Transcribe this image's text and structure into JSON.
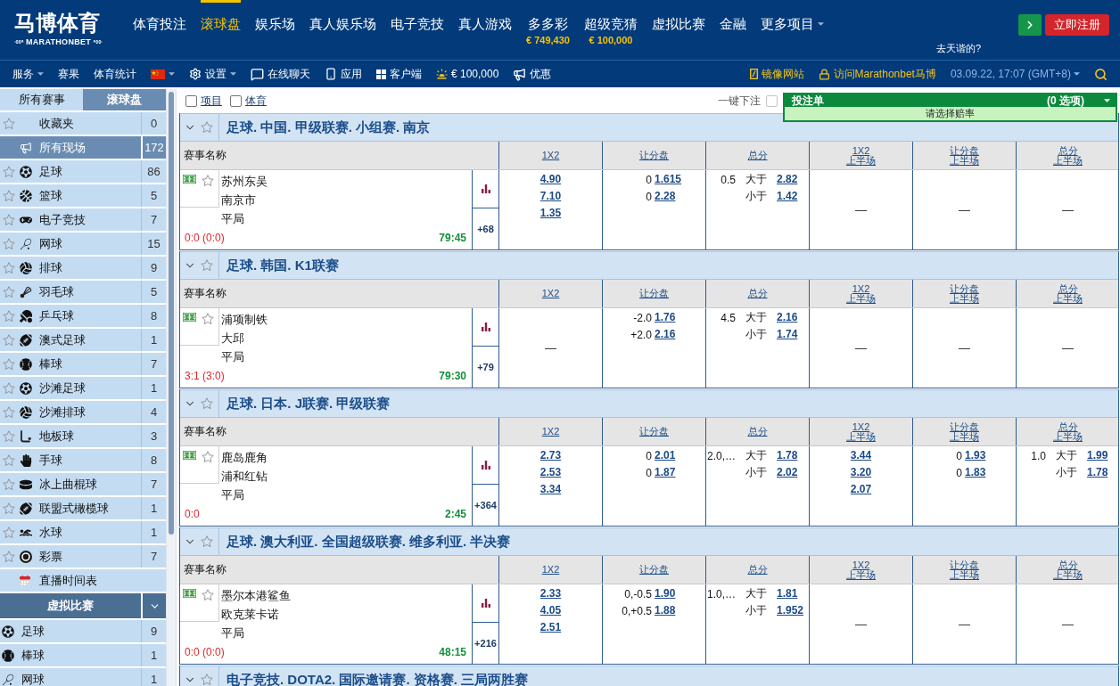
{
  "header": {
    "logo": {
      "title": "马博体育",
      "subtitle": "MARATHONBET"
    },
    "nav": [
      {
        "label": "体育投注",
        "kind": "link",
        "selected": false
      },
      {
        "label": "滚球盘",
        "kind": "link",
        "selected": true
      },
      {
        "label": "娱乐场",
        "kind": "link",
        "selected": false
      },
      {
        "label": "真人娱乐场",
        "kind": "link",
        "selected": false
      },
      {
        "label": "电子竞技",
        "kind": "link",
        "selected": false
      },
      {
        "label": "真人游戏",
        "kind": "link",
        "selected": false
      },
      {
        "label": "多多彩",
        "kind": "link",
        "selected": false,
        "jackpot": "€ 749,430"
      },
      {
        "label": "超级竞猜",
        "kind": "link",
        "selected": false,
        "jackpot": "€ 100,000"
      },
      {
        "label": "虚拟比赛",
        "kind": "link",
        "selected": false
      },
      {
        "label": "金融",
        "kind": "link",
        "selected": false
      },
      {
        "label": "更多项目",
        "kind": "menu",
        "selected": false
      }
    ],
    "register_button": "立即注册",
    "hint": "去天谐的?"
  },
  "toolbar": {
    "items": [
      {
        "kind": "menu",
        "label": "服务"
      },
      {
        "kind": "link",
        "label": "赛果"
      },
      {
        "kind": "link",
        "label": "体育统计"
      },
      {
        "kind": "flag"
      },
      {
        "kind": "menu",
        "label": "设置"
      },
      {
        "kind": "link",
        "label": "在线聊天"
      },
      {
        "kind": "link",
        "label": "应用"
      },
      {
        "kind": "link",
        "label": "客户端"
      },
      {
        "kind": "link",
        "label": "€ 100,000"
      },
      {
        "kind": "link",
        "label": "优惠"
      }
    ],
    "right_links": [
      {
        "label": "镜像网站"
      },
      {
        "label": "访问Marathonbet马博"
      }
    ],
    "datetime": "03.09.22, 17:07 (GMT+8)"
  },
  "sidebar": {
    "tabs": [
      {
        "label": "所有赛事",
        "selected": false
      },
      {
        "label": "滚球盘",
        "selected": true
      }
    ],
    "items": [
      {
        "kind": "favorites",
        "label": "收藏夹",
        "count": "0",
        "selected": false
      },
      {
        "kind": "live",
        "label": "所有现场",
        "count": "172",
        "selected": true
      },
      {
        "kind": "sport",
        "label": "足球",
        "count": "86",
        "selected": false
      },
      {
        "kind": "sport",
        "label": "篮球",
        "count": "5",
        "selected": false
      },
      {
        "kind": "sport",
        "label": "电子竞技",
        "count": "7",
        "selected": false
      },
      {
        "kind": "sport",
        "label": "网球",
        "count": "15",
        "selected": false
      },
      {
        "kind": "sport",
        "label": "排球",
        "count": "9",
        "selected": false
      },
      {
        "kind": "sport",
        "label": "羽毛球",
        "count": "5",
        "selected": false
      },
      {
        "kind": "sport",
        "label": "乒乓球",
        "count": "8",
        "selected": false
      },
      {
        "kind": "sport",
        "label": "澳式足球",
        "count": "1",
        "selected": false
      },
      {
        "kind": "sport",
        "label": "棒球",
        "count": "7",
        "selected": false
      },
      {
        "kind": "sport",
        "label": "沙滩足球",
        "count": "1",
        "selected": false
      },
      {
        "kind": "sport",
        "label": "沙滩排球",
        "count": "4",
        "selected": false
      },
      {
        "kind": "sport",
        "label": "地板球",
        "count": "3",
        "selected": false
      },
      {
        "kind": "sport",
        "label": "手球",
        "count": "8",
        "selected": false
      },
      {
        "kind": "sport",
        "label": "冰上曲棍球",
        "count": "7",
        "selected": false
      },
      {
        "kind": "sport",
        "label": "联盟式橄榄球",
        "count": "1",
        "selected": false
      },
      {
        "kind": "sport",
        "label": "水球",
        "count": "1",
        "selected": false
      },
      {
        "kind": "sport",
        "label": "彩票",
        "count": "7",
        "selected": false
      },
      {
        "kind": "schedule",
        "label": "直播时间表",
        "selected": false
      }
    ],
    "virtual": {
      "title": "虚拟比赛",
      "expanded": true,
      "items": [
        {
          "label": "足球",
          "count": "9",
          "selected": false
        },
        {
          "label": "棒球",
          "count": "1",
          "selected": false
        },
        {
          "label": "网球",
          "count": "1",
          "selected": false
        }
      ]
    }
  },
  "filters": [
    {
      "label": "项目",
      "checked": false
    },
    {
      "label": "体育",
      "checked": false
    }
  ],
  "one_click_bet": {
    "label": "一键下注",
    "checked": false
  },
  "bet_slip": {
    "title": "投注单",
    "count": "(0 选项)",
    "message": "请选择赔率"
  },
  "events": [
    {
      "title": "足球. 中国. 甲级联赛. 小组赛. 南京",
      "expanded": true,
      "heading": "赛事名称",
      "columns": [
        {
          "label": "1X2"
        },
        {
          "label": "让分盘"
        },
        {
          "label": "总分"
        },
        {
          "label": "1X2",
          "period": "上半场"
        },
        {
          "label": "让分盘",
          "period": "上半场"
        },
        {
          "label": "总分",
          "period": "上半场"
        }
      ],
      "match": {
        "selections": [
          "苏州东吴",
          "南京市",
          "平局"
        ],
        "score": "0:0 (0:0)",
        "clock": "79:45",
        "more": "+68",
        "markets": [
          {
            "kind": "three_way",
            "odds": [
              "4.90",
              "7.10",
              "1.35"
            ]
          },
          {
            "kind": "handicap",
            "lines": [
              {
                "line": "0",
                "odd": "1.615"
              },
              {
                "line": "0",
                "odd": "2.28"
              }
            ]
          },
          {
            "kind": "total",
            "line": "0.5",
            "lines": [
              {
                "label": "大于",
                "odd": "2.82"
              },
              {
                "label": "小于",
                "odd": "1.42"
              }
            ]
          },
          {
            "kind": "empty",
            "text": "—"
          },
          {
            "kind": "empty",
            "text": "—"
          },
          {
            "kind": "empty",
            "text": "—"
          }
        ]
      }
    },
    {
      "title": "足球. 韩国. K1联赛",
      "expanded": true,
      "heading": "赛事名称",
      "columns": [
        {
          "label": "1X2"
        },
        {
          "label": "让分盘"
        },
        {
          "label": "总分"
        },
        {
          "label": "1X2",
          "period": "上半场"
        },
        {
          "label": "让分盘",
          "period": "上半场"
        },
        {
          "label": "总分",
          "period": "上半场"
        }
      ],
      "match": {
        "selections": [
          "浦项制铁",
          "大邱",
          "平局"
        ],
        "score": "3:1 (3:0)",
        "clock": "79:30",
        "more": "+79",
        "markets": [
          {
            "kind": "empty",
            "text": "—"
          },
          {
            "kind": "handicap",
            "lines": [
              {
                "line": "-2.0",
                "odd": "1.76"
              },
              {
                "line": "+2.0",
                "odd": "2.16"
              }
            ]
          },
          {
            "kind": "total",
            "line": "4.5",
            "lines": [
              {
                "label": "大于",
                "odd": "2.16"
              },
              {
                "label": "小于",
                "odd": "1.74"
              }
            ]
          },
          {
            "kind": "empty",
            "text": "—"
          },
          {
            "kind": "empty",
            "text": "—"
          },
          {
            "kind": "empty",
            "text": "—"
          }
        ]
      }
    },
    {
      "title": "足球. 日本. J联赛. 甲级联赛",
      "expanded": true,
      "heading": "赛事名称",
      "columns": [
        {
          "label": "1X2"
        },
        {
          "label": "让分盘"
        },
        {
          "label": "总分"
        },
        {
          "label": "1X2",
          "period": "上半场"
        },
        {
          "label": "让分盘",
          "period": "上半场"
        },
        {
          "label": "总分",
          "period": "上半场"
        }
      ],
      "match": {
        "selections": [
          "鹿岛鹿角",
          "浦和红钻",
          "平局"
        ],
        "score": "0:0",
        "clock": "2:45",
        "more": "+364",
        "markets": [
          {
            "kind": "three_way",
            "odds": [
              "2.73",
              "2.53",
              "3.34"
            ]
          },
          {
            "kind": "handicap",
            "lines": [
              {
                "line": "0",
                "odd": "2.01"
              },
              {
                "line": "0",
                "odd": "1.87"
              }
            ]
          },
          {
            "kind": "total",
            "line": "2.0,…",
            "lines": [
              {
                "label": "大于",
                "odd": "1.78"
              },
              {
                "label": "小于",
                "odd": "2.02"
              }
            ]
          },
          {
            "kind": "three_way",
            "odds": [
              "3.44",
              "3.20",
              "2.07"
            ]
          },
          {
            "kind": "handicap",
            "lines": [
              {
                "line": "0",
                "odd": "1.93"
              },
              {
                "line": "0",
                "odd": "1.83"
              }
            ]
          },
          {
            "kind": "total",
            "line": "1.0",
            "lines": [
              {
                "label": "大于",
                "odd": "1.99"
              },
              {
                "label": "小于",
                "odd": "1.78"
              }
            ]
          }
        ]
      }
    },
    {
      "title": "足球. 澳大利亚. 全国超级联赛. 维多利亚. 半决赛",
      "expanded": true,
      "heading": "赛事名称",
      "columns": [
        {
          "label": "1X2"
        },
        {
          "label": "让分盘"
        },
        {
          "label": "总分"
        },
        {
          "label": "1X2",
          "period": "上半场"
        },
        {
          "label": "让分盘",
          "period": "上半场"
        },
        {
          "label": "总分",
          "period": "上半场"
        }
      ],
      "match": {
        "selections": [
          "墨尔本港鲨鱼",
          "欧克莱卡诺",
          "平局"
        ],
        "score": "0:0 (0:0)",
        "clock": "48:15",
        "more": "+216",
        "markets": [
          {
            "kind": "three_way",
            "odds": [
              "2.33",
              "4.05",
              "2.51"
            ]
          },
          {
            "kind": "handicap",
            "lines": [
              {
                "line": "0,-0.5",
                "odd": "1.90"
              },
              {
                "line": "0,+0.5",
                "odd": "1.88"
              }
            ]
          },
          {
            "kind": "total",
            "line": "1.0,…",
            "lines": [
              {
                "label": "大于",
                "odd": "1.81"
              },
              {
                "label": "小于",
                "odd": "1.952"
              }
            ]
          },
          {
            "kind": "empty",
            "text": "—"
          },
          {
            "kind": "empty",
            "text": "—"
          },
          {
            "kind": "empty",
            "text": "—"
          }
        ]
      }
    },
    {
      "title": "电子竞技. DOTA2. 国际邀请赛. 资格赛. 三局两胜赛",
      "expanded": true
    }
  ]
}
